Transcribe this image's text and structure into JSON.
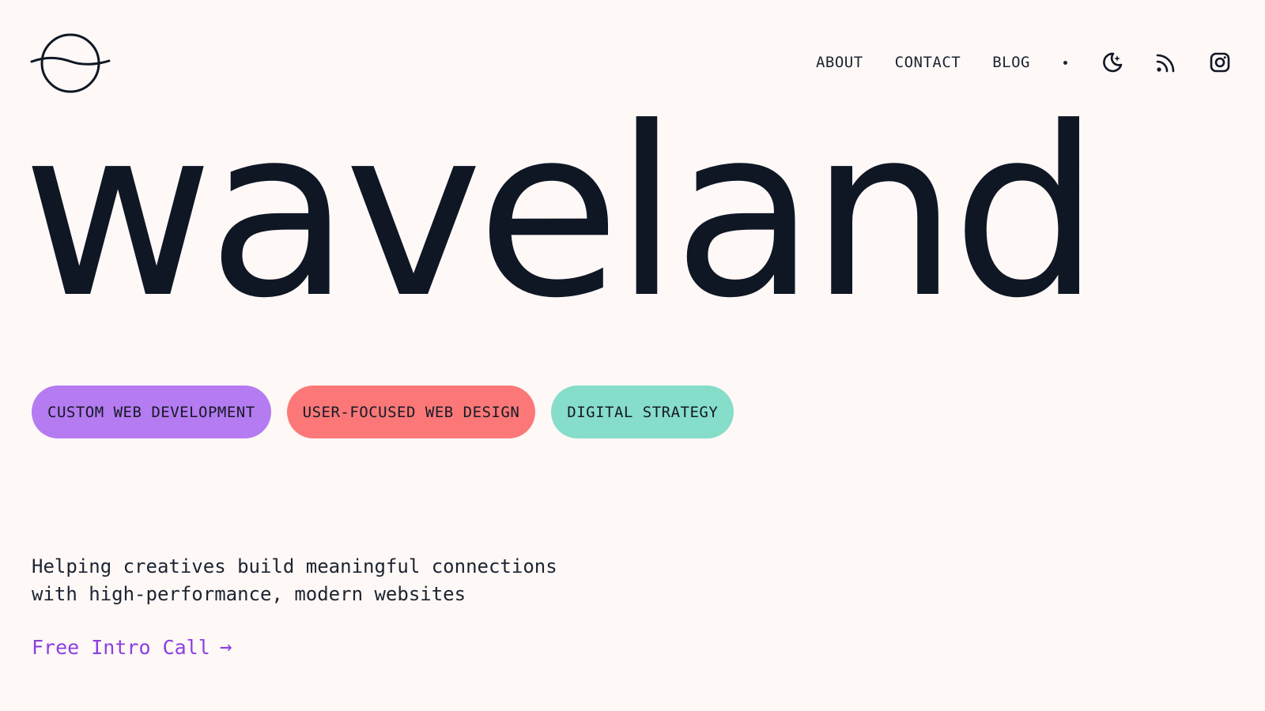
{
  "brand": {
    "logo_icon": "planet-wave-logo",
    "wordmark": "waveland"
  },
  "nav": {
    "links": [
      "ABOUT",
      "CONTACT",
      "BLOG"
    ],
    "icons": [
      "moon-stars-icon",
      "rss-icon",
      "instagram-icon"
    ]
  },
  "tags": [
    {
      "label": "CUSTOM WEB DEVELOPMENT",
      "color": "#b57bf0"
    },
    {
      "label": "USER-FOCUSED WEB DESIGN",
      "color": "#fc7878"
    },
    {
      "label": "DIGITAL STRATEGY",
      "color": "#86ddc9"
    }
  ],
  "hero": {
    "tagline_line1": "Helping creatives build meaningful connections",
    "tagline_line2": "with high-performance, modern websites",
    "cta_label": "Free Intro Call",
    "cta_arrow": "→"
  },
  "colors": {
    "background": "#fef8f7",
    "text": "#0f1724",
    "accent": "#8b3fe0"
  }
}
